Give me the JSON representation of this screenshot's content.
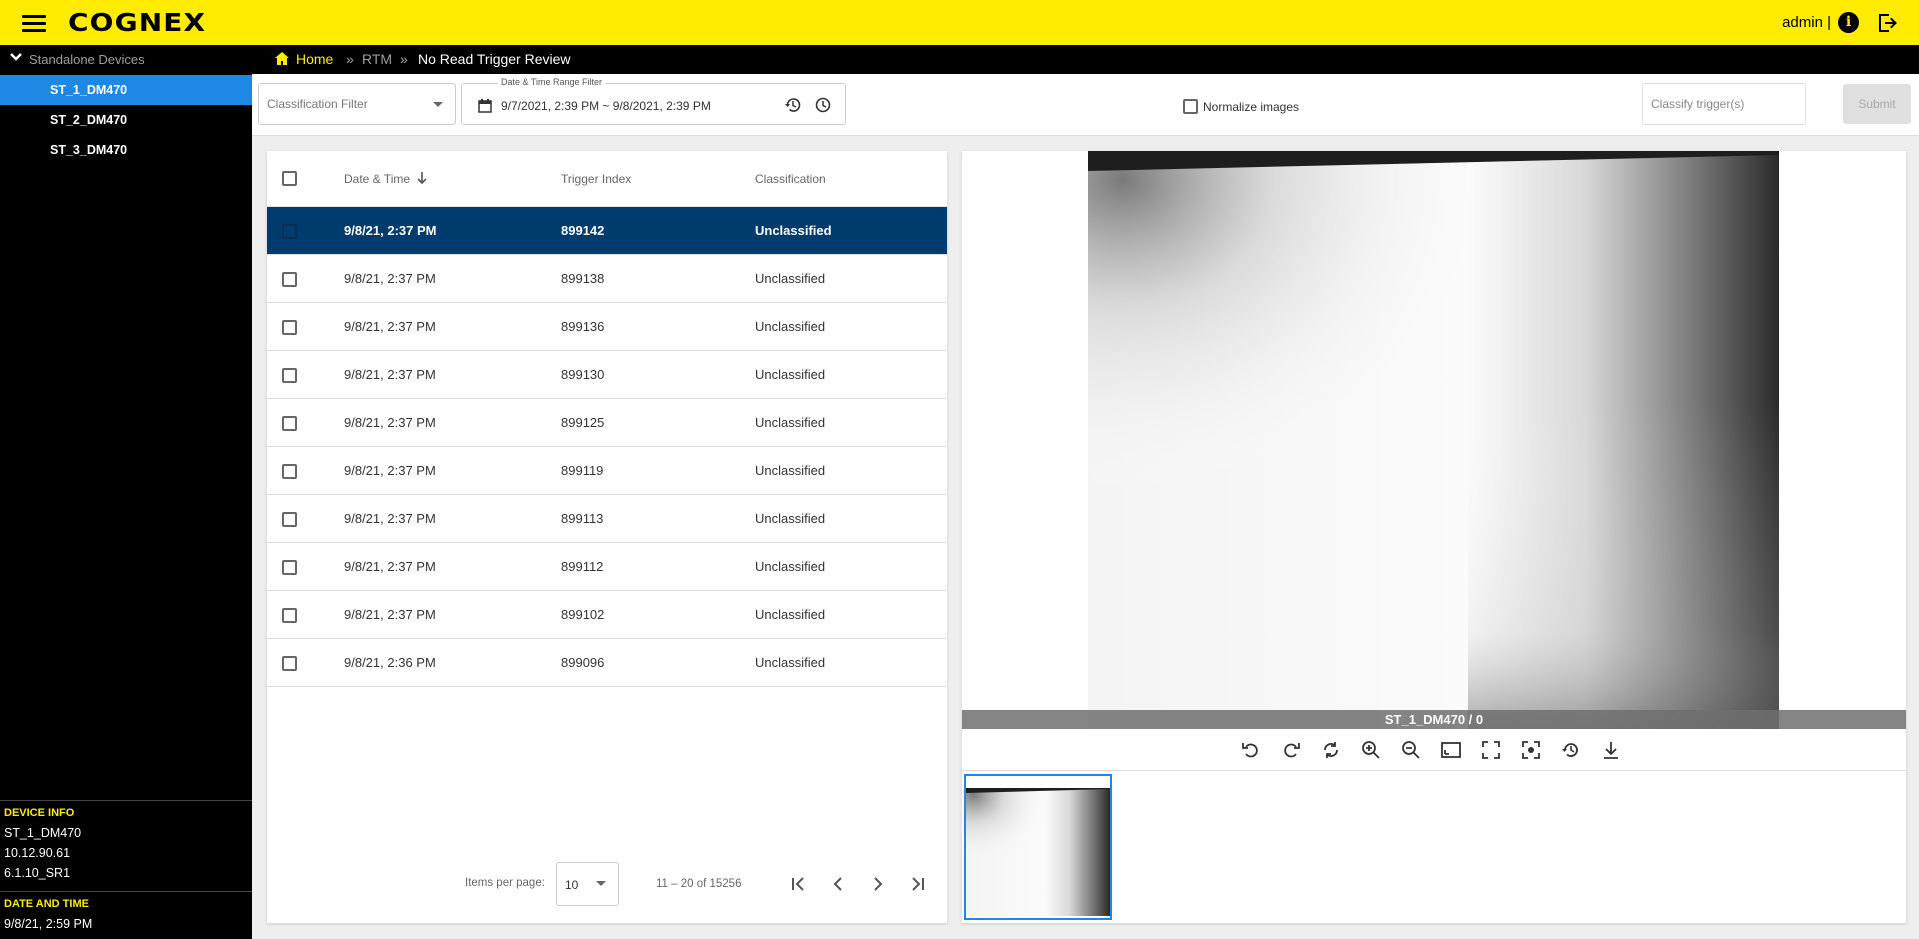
{
  "app": {
    "brand": "COGNEX",
    "user": "admin |"
  },
  "sidebar": {
    "group_label": "Standalone Devices",
    "devices": [
      {
        "label": "ST_1_DM470",
        "active": true
      },
      {
        "label": "ST_2_DM470",
        "active": false
      },
      {
        "label": "ST_3_DM470",
        "active": false
      }
    ],
    "device_info": {
      "heading": "DEVICE INFO",
      "name": "ST_1_DM470",
      "ip": "10.12.90.61",
      "firmware": "6.1.10_SR1"
    },
    "date_time": {
      "heading": "DATE AND TIME",
      "value": "9/8/21, 2:59 PM"
    }
  },
  "breadcrumb": {
    "home": "Home",
    "sep": "»",
    "rtm": "RTM",
    "current": "No Read Trigger Review"
  },
  "filters": {
    "classification_placeholder": "Classification Filter",
    "date_range_label": "Date & Time Range Filter",
    "date_range_value": "9/7/2021, 2:39 PM ~ 9/8/2021, 2:39 PM",
    "normalize_label": "Normalize images",
    "normalize_checked": false,
    "classify_placeholder": "Classify trigger(s)",
    "submit_label": "Submit"
  },
  "table": {
    "headers": {
      "datetime": "Date & Time",
      "trigger_index": "Trigger Index",
      "classification": "Classification"
    },
    "rows": [
      {
        "datetime": "9/8/21, 2:37 PM",
        "trigger_index": "899142",
        "classification": "Unclassified",
        "selected": true
      },
      {
        "datetime": "9/8/21, 2:37 PM",
        "trigger_index": "899138",
        "classification": "Unclassified",
        "selected": false
      },
      {
        "datetime": "9/8/21, 2:37 PM",
        "trigger_index": "899136",
        "classification": "Unclassified",
        "selected": false
      },
      {
        "datetime": "9/8/21, 2:37 PM",
        "trigger_index": "899130",
        "classification": "Unclassified",
        "selected": false
      },
      {
        "datetime": "9/8/21, 2:37 PM",
        "trigger_index": "899125",
        "classification": "Unclassified",
        "selected": false
      },
      {
        "datetime": "9/8/21, 2:37 PM",
        "trigger_index": "899119",
        "classification": "Unclassified",
        "selected": false
      },
      {
        "datetime": "9/8/21, 2:37 PM",
        "trigger_index": "899113",
        "classification": "Unclassified",
        "selected": false
      },
      {
        "datetime": "9/8/21, 2:37 PM",
        "trigger_index": "899112",
        "classification": "Unclassified",
        "selected": false
      },
      {
        "datetime": "9/8/21, 2:37 PM",
        "trigger_index": "899102",
        "classification": "Unclassified",
        "selected": false
      },
      {
        "datetime": "9/8/21, 2:36 PM",
        "trigger_index": "899096",
        "classification": "Unclassified",
        "selected": false
      }
    ],
    "paginator": {
      "items_per_page_label": "Items per page:",
      "page_size": "10",
      "range_label": "11 – 20 of 15256"
    }
  },
  "viewer": {
    "caption": "ST_1_DM470 / 0",
    "tools": [
      "rotate-left-icon",
      "rotate-right-icon",
      "flip-icon",
      "zoom-in-icon",
      "zoom-out-icon",
      "fit-screen-icon",
      "fullscreen-icon",
      "center-focus-icon",
      "reset-icon",
      "download-icon"
    ]
  },
  "colors": {
    "brand_yellow": "#ffec00",
    "selected_row": "#003b6e",
    "active_device": "#1e88e5"
  }
}
